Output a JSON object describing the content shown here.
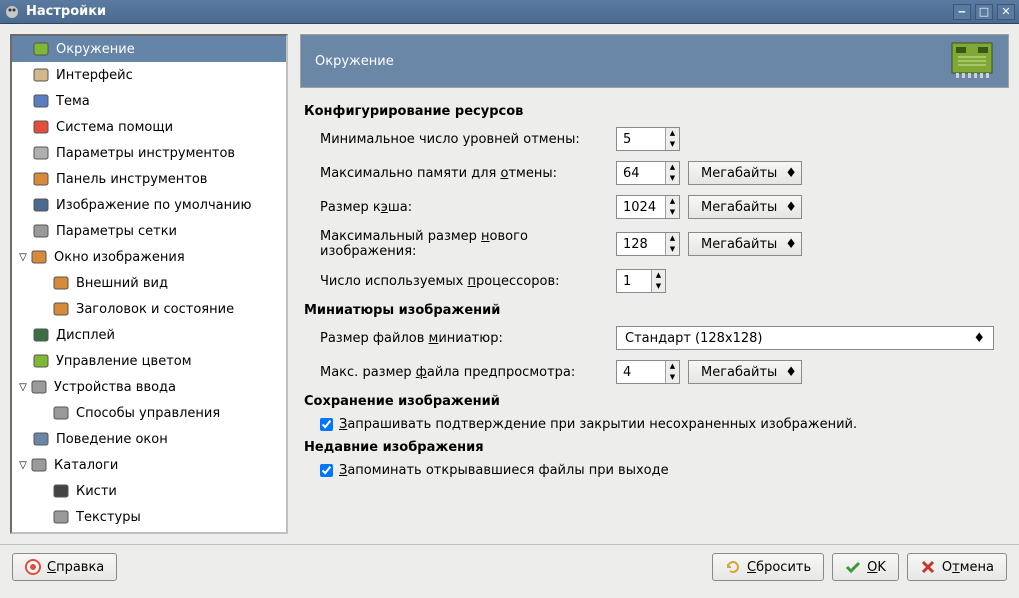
{
  "window": {
    "title": "Настройки"
  },
  "sidebar": {
    "items": [
      {
        "label": "Окружение",
        "selected": true,
        "level": 0,
        "icon": "#7fb834"
      },
      {
        "label": "Интерфейс",
        "level": 0,
        "icon": "#d2b98c"
      },
      {
        "label": "Тема",
        "level": 0,
        "icon": "#5a7fbf"
      },
      {
        "label": "Система помощи",
        "level": 0,
        "icon": "#e64c3c"
      },
      {
        "label": "Параметры инструментов",
        "level": 0,
        "icon": "#b0b0b0"
      },
      {
        "label": "Панель инструментов",
        "level": 0,
        "icon": "#d78a3a"
      },
      {
        "label": "Изображение по умолчанию",
        "level": 0,
        "icon": "#4a6a91"
      },
      {
        "label": "Параметры сетки",
        "level": 0,
        "icon": "#9a9a9a"
      },
      {
        "label": "Окно изображения",
        "level": 0,
        "toggle": true,
        "icon": "#d78a3a"
      },
      {
        "label": "Внешний вид",
        "level": 1,
        "icon": "#d78a3a"
      },
      {
        "label": "Заголовок и состояние",
        "level": 1,
        "icon": "#d78a3a"
      },
      {
        "label": "Дисплей",
        "level": 0,
        "icon": "#3a6f45"
      },
      {
        "label": "Управление цветом",
        "level": 0,
        "icon": "#7fb834"
      },
      {
        "label": "Устройства ввода",
        "level": 0,
        "toggle": true,
        "icon": "#9a9a9a"
      },
      {
        "label": "Способы управления",
        "level": 1,
        "icon": "#9a9a9a"
      },
      {
        "label": "Поведение окон",
        "level": 0,
        "icon": "#6b87a8"
      },
      {
        "label": "Каталоги",
        "level": 0,
        "toggle": true,
        "icon": "#9a9a9a"
      },
      {
        "label": "Кисти",
        "level": 1,
        "icon": "#444444"
      },
      {
        "label": "Текстуры",
        "level": 1,
        "icon": "#9a9a9a"
      }
    ]
  },
  "panel": {
    "title": "Окружение",
    "sections": {
      "resources": {
        "title": "Конфигурирование ресурсов",
        "undo_levels_label": "Минимальное число уровней отмены:",
        "undo_levels_value": "5",
        "undo_memory_pre": "Максимально памяти для ",
        "undo_memory_u": "о",
        "undo_memory_post": "тмены:",
        "undo_memory_value": "64",
        "cache_pre": "Размер к",
        "cache_u": "э",
        "cache_post": "ша:",
        "cache_value": "1024",
        "max_new_pre": "Максимальный размер ",
        "max_new_u": "н",
        "max_new_post": "ового изображения:",
        "max_new_value": "128",
        "processors_pre": "Число используемых ",
        "processors_u": "п",
        "processors_post": "роцессоров:",
        "processors_value": "1",
        "unit_label": "Мегабайты"
      },
      "thumbs": {
        "title": "Миниатюры изображений",
        "thumb_size_pre": "Размер файлов ",
        "thumb_size_u": "м",
        "thumb_size_post": "иниатюр:",
        "thumb_size_value": "Стандарт (128x128)",
        "max_preview_pre": "Макс. размер ",
        "max_preview_u": "ф",
        "max_preview_post": "айла предпросмотра:",
        "max_preview_value": "4"
      },
      "save": {
        "title": "Сохранение изображений",
        "confirm_pre": "",
        "confirm_u": "З",
        "confirm_post": "апрашивать подтверждение при закрытии несохраненных изображений."
      },
      "recent": {
        "title": "Недавние изображения",
        "remember_pre": "",
        "remember_u": "З",
        "remember_post": "апоминать открывавшиеся файлы при выходе"
      }
    }
  },
  "footer": {
    "help_u": "С",
    "help_post": "правка",
    "reset_u": "С",
    "reset_post": "бросить",
    "ok_u": "O",
    "ok_post": "K",
    "cancel_pre": "О",
    "cancel_u": "т",
    "cancel_post": "мена"
  }
}
